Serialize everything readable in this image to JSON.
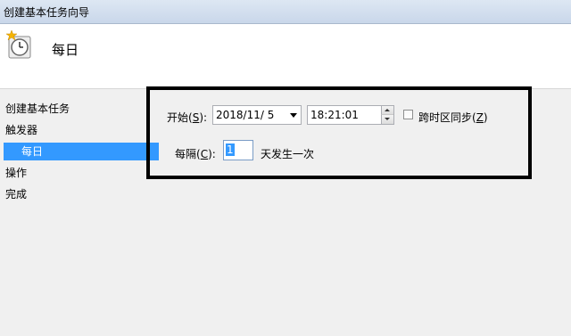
{
  "window": {
    "title": "创建基本任务向导"
  },
  "header": {
    "heading": "每日",
    "icon": "clock-icon"
  },
  "steps": [
    {
      "label": "创建基本任务"
    },
    {
      "label": "触发器"
    },
    {
      "label": "每日",
      "selected": true
    },
    {
      "label": "操作"
    },
    {
      "label": "完成"
    }
  ],
  "form": {
    "start_label_pre": "开始(",
    "start_label_key": "S",
    "start_label_post": "):",
    "date_value": "2018/11/  5",
    "time_value": "18:21:01",
    "sync_label_pre": "跨时区同步(",
    "sync_label_key": "Z",
    "sync_label_post": ")",
    "sync_checked": false,
    "interval_label_pre": "每隔(",
    "interval_label_key": "C",
    "interval_label_post": "):",
    "interval_value": "1",
    "interval_suffix": "天发生一次"
  },
  "colors": {
    "selection": "#3399ff",
    "annotation_box": "#000000"
  }
}
